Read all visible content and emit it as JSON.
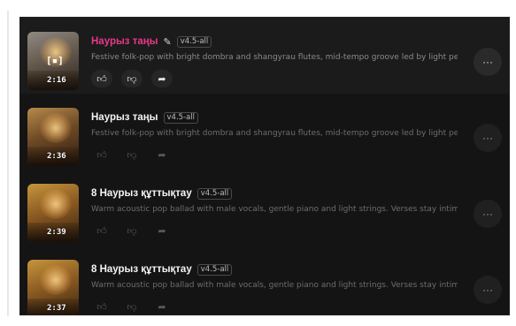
{
  "songs": [
    {
      "title": "Наурыз таңы",
      "version": "v4.5-all",
      "description": "Festive folk-pop with bright dombra and shangyrau flutes, mid-tempo groove led by light perc...",
      "duration": "2:16",
      "editable": true
    },
    {
      "title": "Наурыз таңы",
      "version": "v4.5-all",
      "description": "Festive folk-pop with bright dombra and shangyrau flutes, mid-tempo groove led by light perc...",
      "duration": "2:36"
    },
    {
      "title": "8 Наурыз құттықтау",
      "version": "v4.5-all",
      "description": "Warm acoustic pop ballad with male vocals, gentle piano and light strings. Verses stay intimat...",
      "duration": "2:39"
    },
    {
      "title": "8 Наурыз құттықтау",
      "version": "v4.5-all",
      "description": "Warm acoustic pop ballad with male vocals, gentle piano and light strings. Verses stay intimat...",
      "duration": "2:37"
    }
  ],
  "icons": {
    "like": "thumbs-up-icon",
    "dislike": "thumbs-down-icon",
    "share": "share-arrow-icon",
    "more": "more-options-icon",
    "edit": "pencil-icon"
  },
  "accent_color": "#e8388a"
}
